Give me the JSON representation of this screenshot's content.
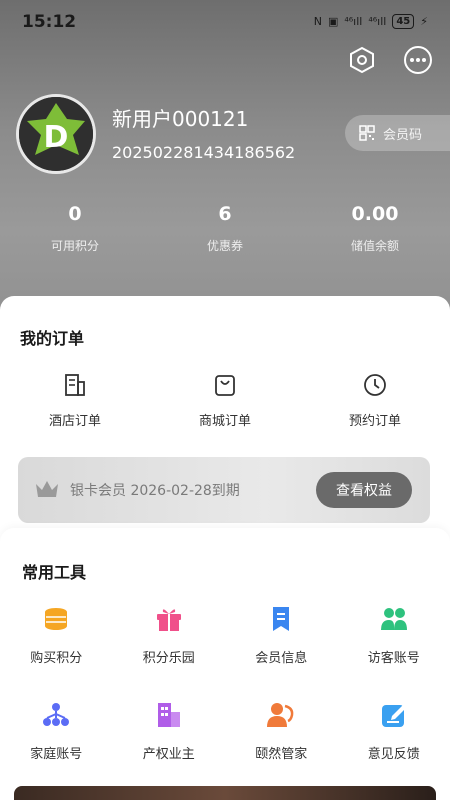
{
  "status_bar": {
    "time": "15:12",
    "signal_1": "⁴⁶ıll",
    "signal_2": "⁴⁶ıll",
    "battery": "45"
  },
  "header_icons": [
    "settings-hexagon-icon",
    "more-icon"
  ],
  "profile": {
    "username": "新用户000121",
    "user_id": "20250228143418​6562",
    "member_code_label": "会员码"
  },
  "stats": [
    {
      "value": "0",
      "label": "可用积分"
    },
    {
      "value": "6",
      "label": "优惠券"
    },
    {
      "value": "0.00",
      "label": "储值余额"
    }
  ],
  "orders": {
    "title": "我的订单",
    "items": [
      {
        "label": "酒店订单",
        "icon": "hotel-order-icon"
      },
      {
        "label": "商城订单",
        "icon": "shopping-bag-icon"
      },
      {
        "label": "预约订单",
        "icon": "clock-icon"
      }
    ]
  },
  "membership": {
    "text": "银卡会员 2026-02-28到期",
    "button": "查看权益",
    "icon": "crown-icon"
  },
  "tools": {
    "title": "常用工具",
    "items": [
      {
        "label": "购买积分",
        "icon": "coins-icon",
        "color": "#f5a623"
      },
      {
        "label": "积分乐园",
        "icon": "gift-icon",
        "color": "#f0508a"
      },
      {
        "label": "会员信息",
        "icon": "bookmark-icon",
        "color": "#3a86f0"
      },
      {
        "label": "访客账号",
        "icon": "users-icon",
        "color": "#2ec27e"
      },
      {
        "label": "家庭账号",
        "icon": "org-tree-icon",
        "color": "#5b6cf5"
      },
      {
        "label": "产权业主",
        "icon": "building-icon",
        "color": "#b05de8"
      },
      {
        "label": "颐然管家",
        "icon": "butler-icon",
        "color": "#f07a3a"
      },
      {
        "label": "意见反馈",
        "icon": "feedback-edit-icon",
        "color": "#3aa0f0"
      }
    ]
  },
  "colors": {
    "hero_gray": "#8c8c8c",
    "vip_button": "#6a6a6a"
  }
}
